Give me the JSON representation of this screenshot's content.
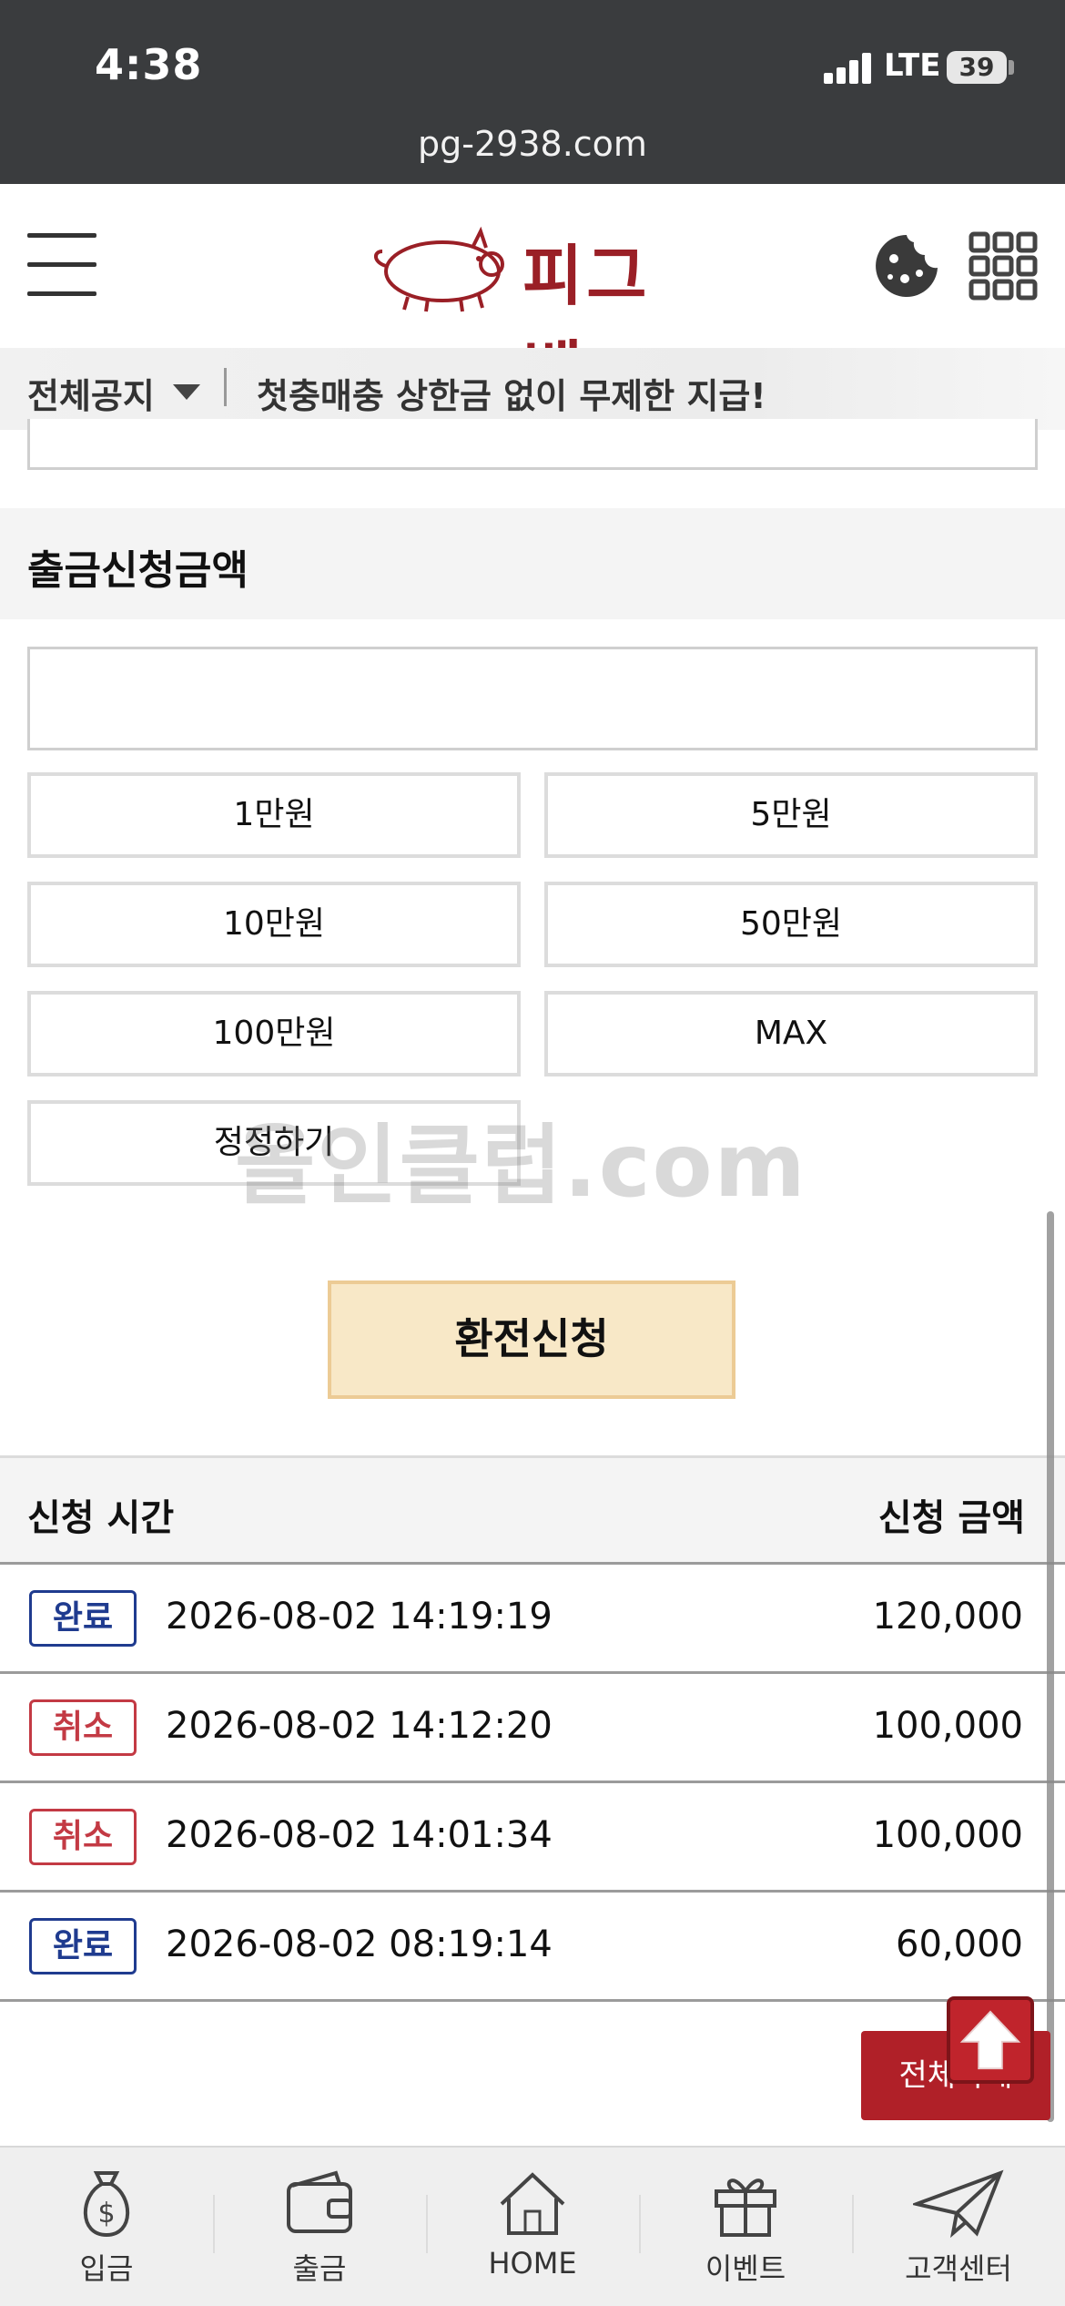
{
  "status": {
    "time": "4:38",
    "network": "LTE",
    "battery": "39"
  },
  "browser": {
    "url": "pg-2938.com"
  },
  "header": {
    "logo_text": "피그벳"
  },
  "notice": {
    "category": "전체공지",
    "message": "첫충매충 상한금 없이 무제한 지급!"
  },
  "withdraw": {
    "section_title": "출금신청금액",
    "amount_value": "",
    "quick_buttons": [
      "1만원",
      "5만원",
      "10만원",
      "50만원",
      "100만원",
      "MAX"
    ],
    "reset_label": "정정하기",
    "submit_label": "환전신청"
  },
  "watermark": "올인클럽.com",
  "history": {
    "headers": {
      "time": "신청 시간",
      "amount": "신청 금액"
    },
    "rows": [
      {
        "status": "완료",
        "datetime": "2026-08-02 14:19:19",
        "amount": "120,000"
      },
      {
        "status": "취소",
        "datetime": "2026-08-02 14:12:20",
        "amount": "100,000"
      },
      {
        "status": "취소",
        "datetime": "2026-08-02 14:01:34",
        "amount": "100,000"
      },
      {
        "status": "완료",
        "datetime": "2026-08-02 08:19:14",
        "amount": "60,000"
      }
    ]
  },
  "floating": {
    "all_button": "전체삭제"
  },
  "bottom_nav": [
    {
      "label": "입금",
      "icon": "money-bag-icon"
    },
    {
      "label": "출금",
      "icon": "wallet-icon"
    },
    {
      "label": "HOME",
      "icon": "home-icon"
    },
    {
      "label": "이벤트",
      "icon": "gift-icon"
    },
    {
      "label": "고객센터",
      "icon": "paper-plane-icon"
    }
  ],
  "colors": {
    "brand": "#9a1f26",
    "done": "#1f3b8f",
    "cancel": "#c33a44",
    "submit_bg": "#f8e8c7"
  }
}
